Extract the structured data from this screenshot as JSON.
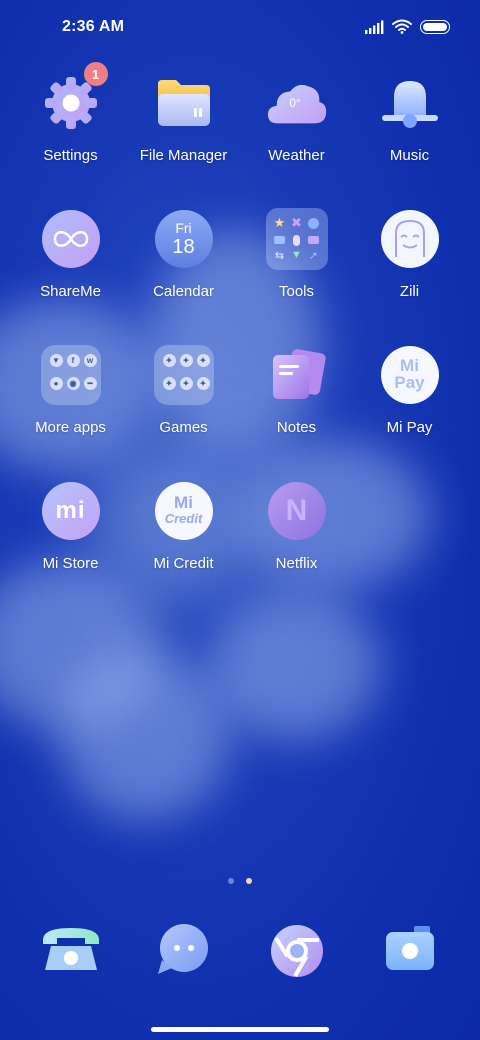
{
  "status": {
    "time": "2:36 AM"
  },
  "settings": {
    "badge": "1"
  },
  "apps": [
    {
      "label": "Settings"
    },
    {
      "label": "File Manager"
    },
    {
      "label": "Weather",
      "temp": "0°"
    },
    {
      "label": "Music"
    },
    {
      "label": "ShareMe"
    },
    {
      "label": "Calendar",
      "day": "Fri",
      "date": "18"
    },
    {
      "label": "Tools"
    },
    {
      "label": "Zili"
    },
    {
      "label": "More apps"
    },
    {
      "label": "Games"
    },
    {
      "label": "Notes"
    },
    {
      "label": "Mi Pay",
      "logo_line1": "Mi",
      "logo_line2": "Pay"
    },
    {
      "label": "Mi Store",
      "logo": "mi"
    },
    {
      "label": "Mi Credit",
      "logo_line1": "Mi",
      "logo_line2": "Credit"
    },
    {
      "label": "Netflix",
      "logo": "N"
    }
  ],
  "more_apps_letters": [
    "f",
    "w"
  ],
  "page_indicator": {
    "pages": 2,
    "current": 2
  },
  "dock": [
    {
      "name": "phone-icon"
    },
    {
      "name": "messages-icon"
    },
    {
      "name": "browser-icon"
    },
    {
      "name": "camera-icon"
    }
  ],
  "colors": {
    "badge": "#f27e83",
    "active_dot": "#f5d9a8",
    "inactive_dot": "#6f86d8"
  }
}
